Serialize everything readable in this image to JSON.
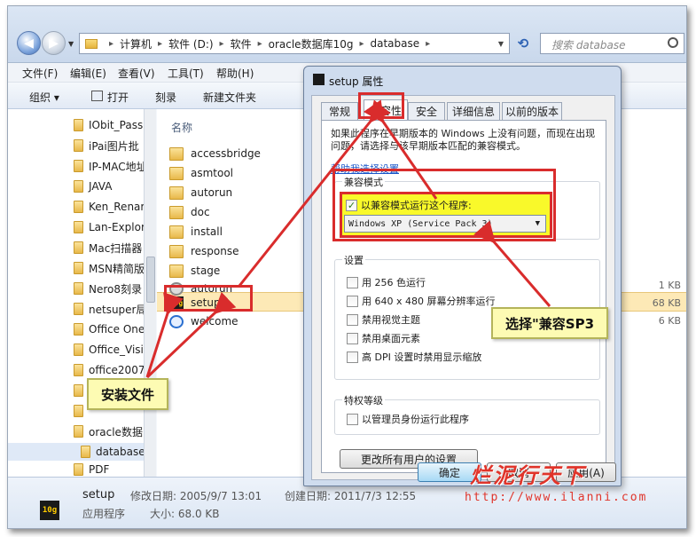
{
  "explorer": {
    "path": [
      "计算机",
      "软件 (D:)",
      "软件",
      "oracle数据库10g",
      "database"
    ],
    "search_placeholder": "搜索 database",
    "menu": [
      "文件(F)",
      "编辑(E)",
      "查看(V)",
      "工具(T)",
      "帮助(H)"
    ],
    "toolbar": {
      "organize": "组织 ▾",
      "open": "打开",
      "burn": "刻录",
      "new_folder": "新建文件夹"
    },
    "nav_items": [
      "IObit_Pass",
      "iPai图片批",
      "IP-MAC地址",
      "JAVA",
      "Ken_Renar",
      "Lan-Explor",
      "Mac扫描器",
      "MSN精简版",
      "Nero8刻录",
      "netsuper局",
      "Office One",
      "Office_Visi",
      "office2007",
      "",
      "",
      "oracle数据",
      "database",
      "PDF"
    ],
    "column_header": "名称",
    "files": [
      {
        "name": "accessbridge",
        "icon": "folder-icon"
      },
      {
        "name": "asmtool",
        "icon": "folder-icon"
      },
      {
        "name": "autorun",
        "icon": "folder-icon"
      },
      {
        "name": "doc",
        "icon": "folder-icon"
      },
      {
        "name": "install",
        "icon": "folder-icon"
      },
      {
        "name": "response",
        "icon": "folder-icon"
      },
      {
        "name": "stage",
        "icon": "folder-icon"
      },
      {
        "name": "autorun",
        "icon": "settings-file-icon"
      },
      {
        "name": "setup",
        "icon": "setup-exe-icon"
      },
      {
        "name": "welcome",
        "icon": "ie-html-icon"
      }
    ],
    "sizes": [
      "1 KB",
      "68 KB",
      "6 KB"
    ],
    "status": {
      "name": "setup",
      "modified_label": "修改日期: 2005/9/7 13:01",
      "created_label": "创建日期: 2011/7/3 12:55",
      "type_label": "应用程序",
      "size_label": "大小: 68.0 KB"
    }
  },
  "dialog": {
    "title": "setup 属性",
    "tabs": [
      "常规",
      "兼容性",
      "安全",
      "详细信息",
      "以前的版本"
    ],
    "description": "如果此程序在早期版本的 Windows 上没有问题，而现在出现问题，请选择与该早期版本匹配的兼容模式。",
    "help_link": "帮助我选择设置",
    "compat_group": "兼容模式",
    "compat_checkbox": "以兼容模式运行这个程序:",
    "compat_selected": "Windows XP (Service Pack 3)",
    "settings_group": "设置",
    "settings": [
      "用 256 色运行",
      "用 640 x 480 屏幕分辨率运行",
      "禁用视觉主题",
      "禁用桌面元素",
      "高 DPI 设置时禁用显示缩放"
    ],
    "privilege_group": "特权等级",
    "admin_checkbox": "以管理员身份运行此程序",
    "all_users_button": "更改所有用户的设置",
    "ok_button": "确定",
    "cancel_button": "取消",
    "apply_button": "应用(A)"
  },
  "annotations": {
    "install_file": "安装文件",
    "select_sp3": "选择\"兼容SP3"
  },
  "watermark": {
    "brand": "烂泥行天下",
    "url": "http://www.ilanni.com"
  },
  "colors": {
    "annotation_red": "#d92c2c",
    "highlight_yellow": "#f9f92a",
    "selection": "#fde9b6"
  }
}
